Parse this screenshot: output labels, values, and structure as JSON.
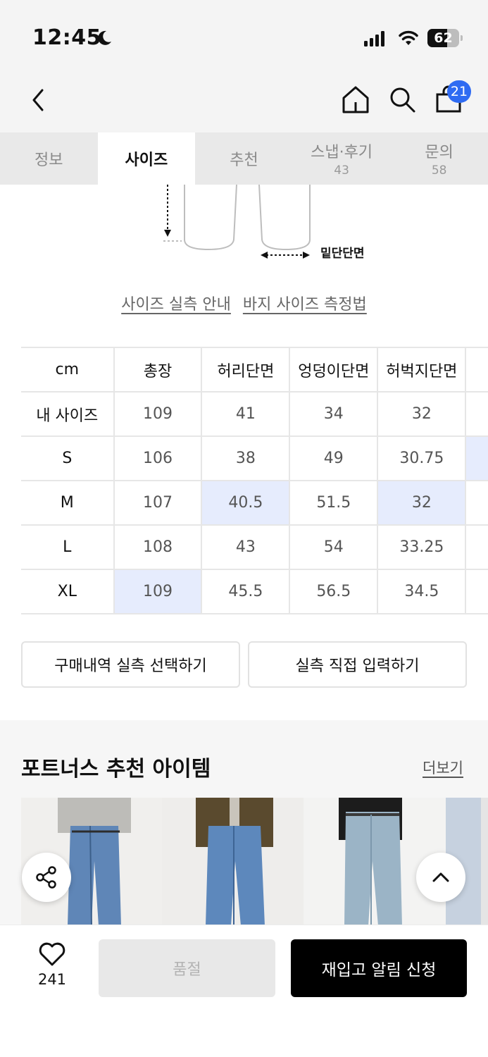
{
  "status_bar": {
    "time": "12:45",
    "battery": "62",
    "battery_level": 0.62,
    "icons": [
      "moon-icon",
      "signal-icon",
      "wifi-icon",
      "battery-icon"
    ]
  },
  "header": {
    "icons": [
      "back-icon",
      "home-icon",
      "search-icon",
      "shopping-bag-icon"
    ],
    "cart_count": "21"
  },
  "tabs": [
    {
      "label": "정보",
      "count": ""
    },
    {
      "label": "사이즈",
      "count": "",
      "active": true
    },
    {
      "label": "추천",
      "count": ""
    },
    {
      "label": "스냅·후기",
      "count": "43"
    },
    {
      "label": "문의",
      "count": "58"
    }
  ],
  "diagram": {
    "label": "밑단단면"
  },
  "links": {
    "size_guide": "사이즈 실측 안내",
    "pants_measure": "바지 사이즈 측정법"
  },
  "size_table": {
    "headers": [
      "cm",
      "총장",
      "허리단면",
      "엉덩이단면",
      "허벅지단면"
    ],
    "rows": [
      {
        "label": "내 사이즈",
        "values": [
          "109",
          "41",
          "34",
          "32"
        ]
      },
      {
        "label": "S",
        "values": [
          "106",
          "38",
          "49",
          "30.75"
        ]
      },
      {
        "label": "M",
        "values": [
          "107",
          "40.5",
          "51.5",
          "32"
        ]
      },
      {
        "label": "L",
        "values": [
          "108",
          "43",
          "54",
          "33.25"
        ]
      },
      {
        "label": "XL",
        "values": [
          "109",
          "45.5",
          "56.5",
          "34.5"
        ]
      }
    ],
    "highlight_color": "#e6ecfd"
  },
  "actions": {
    "select_purchase": "구매내역 실측 선택하기",
    "manual_input": "실측 직접 입력하기"
  },
  "recommend": {
    "title": "포트너스 추천 아이템",
    "more": "더보기"
  },
  "bottom_bar": {
    "like_count": "241",
    "soldout": "품절",
    "restock": "재입고 알림 신청"
  },
  "colors": {
    "accent_blue": "#2f6bf2",
    "primary_black": "#000000"
  }
}
